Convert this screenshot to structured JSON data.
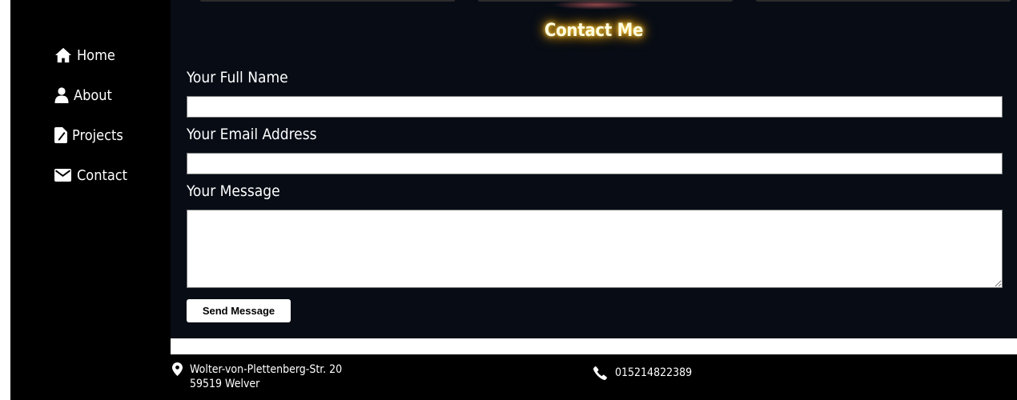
{
  "nav": {
    "items": [
      {
        "label": "Home",
        "icon": "home-icon"
      },
      {
        "label": "About",
        "icon": "user-icon"
      },
      {
        "label": "Projects",
        "icon": "file-icon"
      },
      {
        "label": "Contact",
        "icon": "envelope-icon"
      }
    ]
  },
  "form": {
    "title": "Contact Me",
    "name_label": "Your Full Name",
    "name_value": "",
    "email_label": "Your Email Address",
    "email_value": "",
    "message_label": "Your Message",
    "message_value": "",
    "submit_label": "Send Message"
  },
  "footer": {
    "address_line1": "Wolter-von-Plettenberg-Str. 20",
    "address_line2": "59519 Welver",
    "phone": "015214822389"
  },
  "colors": {
    "main_bg": "#070c15",
    "title_glow": "#ffb400"
  }
}
